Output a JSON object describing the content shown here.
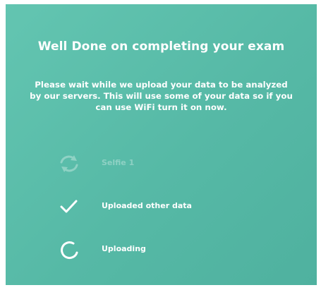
{
  "screen": {
    "title": "Well Done on completing your exam",
    "message_lines": [
      "Please wait while we upload your data to be analyzed",
      "by our servers. This will use some of your data so if you",
      "can use WiFi turn it on now."
    ]
  },
  "status_items": [
    {
      "label": "Selfie 1",
      "icon": "sync-icon",
      "state": "pending"
    },
    {
      "label": "Uploaded other data",
      "icon": "checkmark-icon",
      "state": "done"
    },
    {
      "label": "Uploading",
      "icon": "spinner-icon",
      "state": "in-progress"
    }
  ],
  "colors": {
    "background": "#58bba8",
    "text": "#ffffff"
  }
}
